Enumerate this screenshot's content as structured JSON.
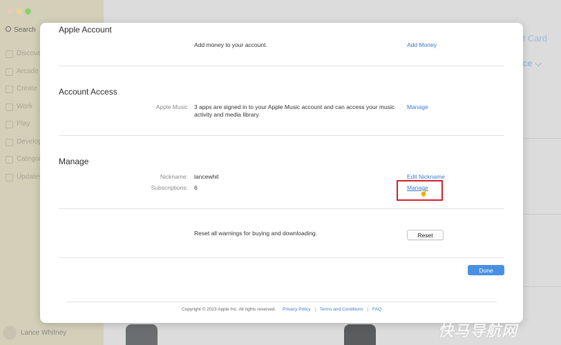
{
  "background": {
    "search_label": "Search",
    "nav_items": [
      "Discover",
      "Arcade",
      "Create",
      "Work",
      "Play",
      "Develop",
      "Categories",
      "Updates"
    ],
    "user_name": "Lance Whitney",
    "right_link_1": "t Card",
    "right_link_2": "nce ⌵"
  },
  "modal": {
    "apple_account": {
      "title": "Apple Account",
      "add_money_text": "Add money to your account.",
      "add_money_link": "Add Money"
    },
    "account_access": {
      "title": "Account Access",
      "label": "Apple Music",
      "text": "3 apps are signed in to your Apple Music account and can access your music activity and media library.",
      "link": "Manage"
    },
    "manage": {
      "title": "Manage",
      "nickname_label": "Nickname:",
      "nickname_value": "lancewhit",
      "nickname_link": "Edit Nickname",
      "subscriptions_label": "Subscriptions:",
      "subscriptions_value": "6",
      "subscriptions_link": "Manage"
    },
    "reset": {
      "text": "Reset all warnings for buying and downloading.",
      "button": "Reset"
    },
    "done_button": "Done",
    "footer": {
      "copyright": "Copyright © 2023 Apple Inc. All rights reserved.",
      "privacy": "Privacy Policy",
      "terms": "Terms and Conditions",
      "faq": "FAQ"
    }
  },
  "watermark": "快马导航网",
  "colors": {
    "link": "#3a7bd5",
    "primary_button": "#4a90e2",
    "highlight": "#d0202a"
  }
}
